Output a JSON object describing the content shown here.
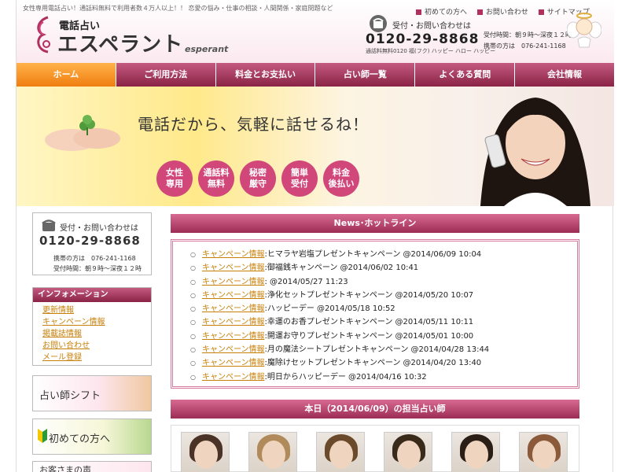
{
  "header": {
    "tagline": "女性専用電話占い！通話料無料で利用者数４万人以上！！ 恋愛の悩み・仕事の相談・人間関係・家庭問題など",
    "logo_small": "電話占い",
    "logo_main": "エスペラント",
    "logo_en": "esperant",
    "contact_label": "受付・お問い合わせは",
    "phone": "0120-29-8868",
    "phone_note": "通話料無料0120 福(フク) ハッピー ハロー ハッピー",
    "links": [
      "初めての方へ",
      "お問い合わせ",
      "サイトマップ"
    ],
    "hours": "受付時間：朝９時～深夜１２時",
    "mobile": "携帯の方は　076-241-1168"
  },
  "nav": {
    "items": [
      "ホーム",
      "ご利用方法",
      "料金とお支払い",
      "占い師一覧",
      "よくある質問",
      "会社情報"
    ],
    "active_index": 0
  },
  "hero": {
    "title": "電話だから、気軽に話せるね！",
    "badges": [
      [
        "女性",
        "専用"
      ],
      [
        "通話料",
        "無料"
      ],
      [
        "秘密",
        "厳守"
      ],
      [
        "簡単",
        "受付"
      ],
      [
        "料金",
        "後払い"
      ]
    ]
  },
  "sidebar": {
    "contact_label": "受付・お問い合わせは",
    "phone": "0120-29-8868",
    "mobile": "携帯の方は　076-241-1168",
    "hours": "受付時間：朝９時～深夜１２時",
    "info_title": "インフォメーション",
    "info_links": [
      "更新情報",
      "キャンペーン情報",
      "掲載誌情報",
      "お問い合わせ",
      "メール登録"
    ],
    "banners": [
      "占い師シフト",
      "初めての方へ",
      "お客さまの声"
    ]
  },
  "news": {
    "title": "News･ホットライン",
    "items": [
      {
        "category": "キャンペーン情報",
        "text": ":ヒマラヤ岩塩プレゼントキャンペーン @2014/06/09 10:04"
      },
      {
        "category": "キャンペーン情報",
        "text": ":御福銭キャンペーン @2014/06/02 10:41"
      },
      {
        "category": "キャンペーン情報",
        "text": ": @2014/05/27 11:23"
      },
      {
        "category": "キャンペーン情報",
        "text": ":浄化セットプレゼントキャンペーン @2014/05/20 10:07"
      },
      {
        "category": "キャンペーン情報",
        "text": ":ハッピーデー @2014/05/18 10:52"
      },
      {
        "category": "キャンペーン情報",
        "text": ":幸運のお香プレゼントキャンペーン @2014/05/11 10:11"
      },
      {
        "category": "キャンペーン情報",
        "text": ":開運お守りプレゼントキャンペーン @2014/05/01 10:00"
      },
      {
        "category": "キャンペーン情報",
        "text": ":月の魔法シートプレゼントキャンペーン @2014/04/28 13:44"
      },
      {
        "category": "キャンペーン情報",
        "text": ":魔除けセットプレゼントキャンペーン @2014/04/20 13:40"
      },
      {
        "category": "キャンペーン情報",
        "text": ":明日からハッピーデー @2014/04/16 10:32"
      }
    ]
  },
  "today": {
    "title": "本日（2014/06/09）の担当占い師",
    "photo_count": 6
  },
  "colors": {
    "accent": "#b03060",
    "nav_active": "#f07e10",
    "link": "#c8800a",
    "badge": "#d1477a"
  }
}
